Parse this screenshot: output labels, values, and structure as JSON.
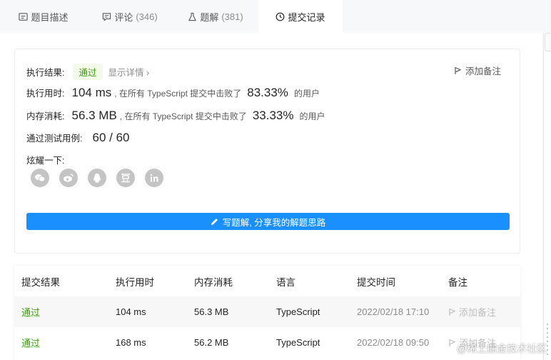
{
  "tabs": [
    {
      "label": "题目描述",
      "icon": "document-icon"
    },
    {
      "label": "评论",
      "count": "(346)",
      "icon": "comment-icon"
    },
    {
      "label": "题解",
      "count": "(381)",
      "icon": "flask-icon"
    },
    {
      "label": "提交记录",
      "icon": "clock-icon",
      "active": true
    }
  ],
  "result": {
    "label": "执行结果:",
    "status": "通过",
    "detail_link": "显示详情 ›",
    "add_note": "添加备注",
    "runtime": {
      "label": "执行用时:",
      "value": "104 ms",
      "mid": ", 在所有 TypeScript 提交中击败了",
      "percent": "83.33%",
      "tail": "的用户"
    },
    "memory": {
      "label": "内存消耗:",
      "value": "56.3 MB",
      "mid": ", 在所有 TypeScript 提交中击败了",
      "percent": "33.33%",
      "tail": "的用户"
    },
    "cases": {
      "label": "通过测试用例:",
      "value": "60 / 60"
    },
    "share_label": "炫耀一下:",
    "share_icons": [
      "wechat-icon",
      "weibo-icon",
      "qq-icon",
      "douban-icon",
      "linkedin-icon"
    ],
    "solution_button": "写题解, 分享我的解题思路"
  },
  "table": {
    "headers": [
      "提交结果",
      "执行用时",
      "内存消耗",
      "语言",
      "提交时间",
      "备注"
    ],
    "rows": [
      {
        "status": "通过",
        "runtime": "104 ms",
        "memory": "56.3 MB",
        "language": "TypeScript",
        "time": "2022/02/18 17:10",
        "note": "添加备注"
      },
      {
        "status": "通过",
        "runtime": "168 ms",
        "memory": "56.2 MB",
        "language": "TypeScript",
        "time": "2022/02/18 09:50",
        "note": "添加备注"
      }
    ]
  },
  "watermark": "@稀土掘金技术社区",
  "colors": {
    "accent": "#1a90ff",
    "pass": "#389e0d"
  }
}
